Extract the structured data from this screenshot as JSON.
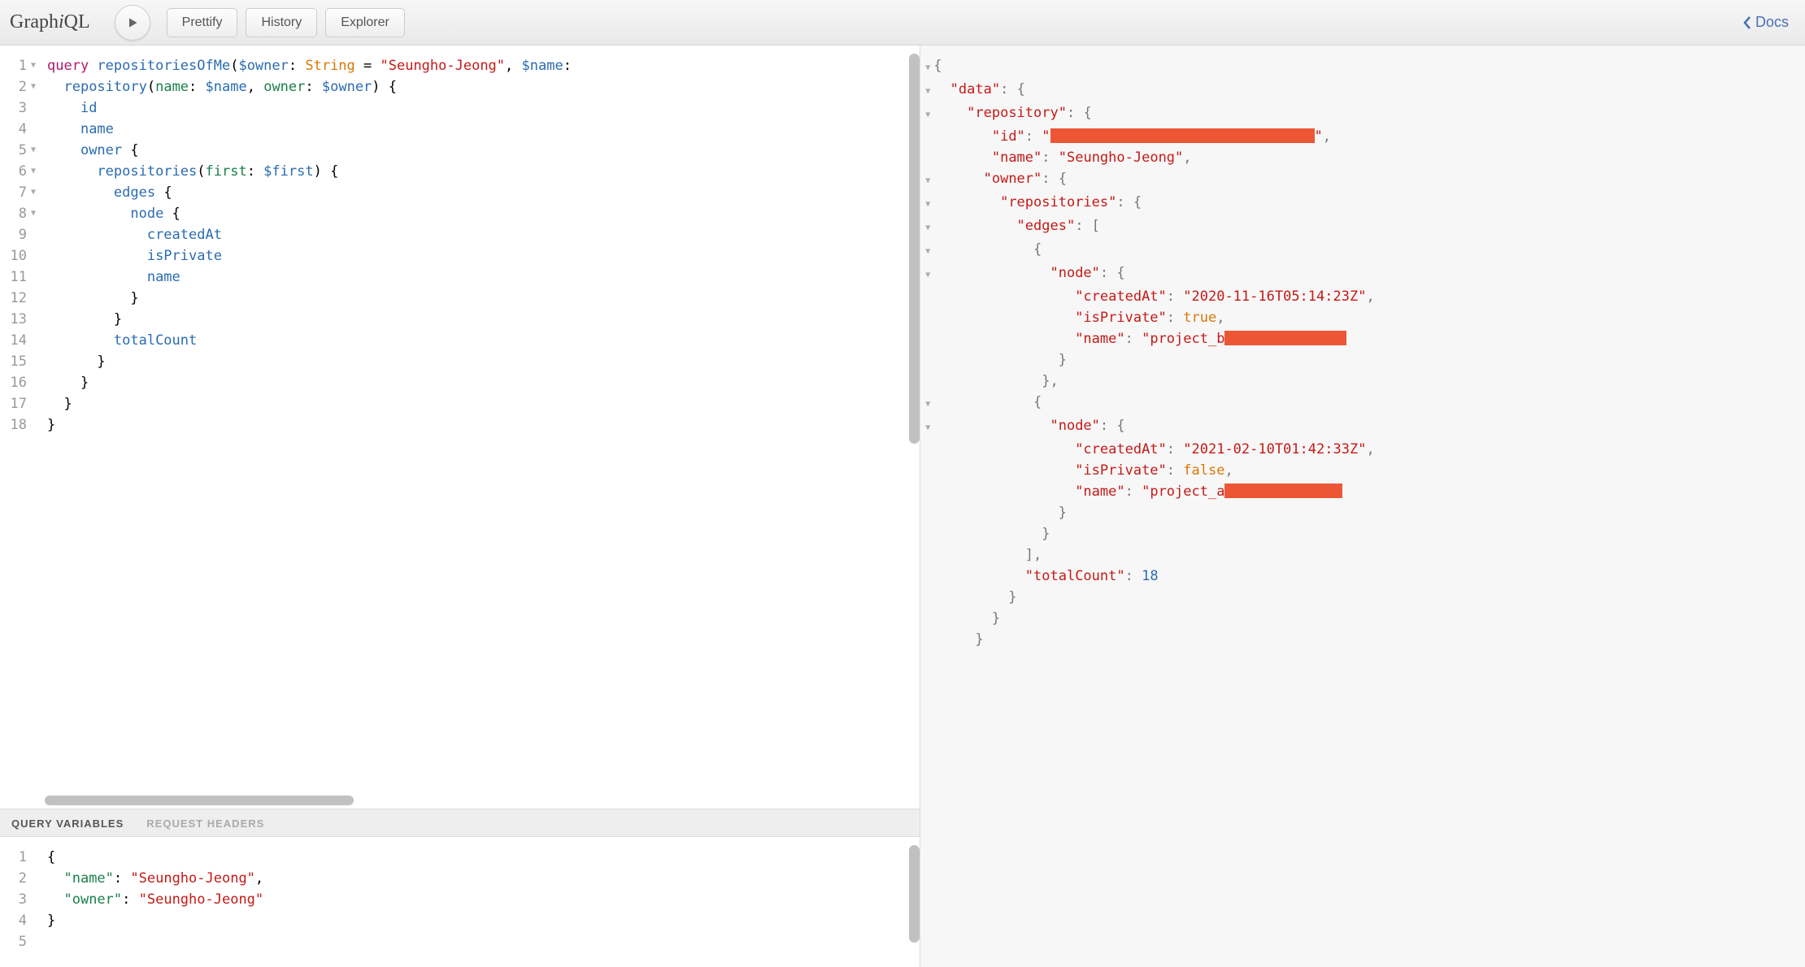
{
  "toolbar": {
    "app_title_parts": [
      "Graph",
      "i",
      "QL"
    ],
    "prettify_label": "Prettify",
    "history_label": "History",
    "explorer_label": "Explorer",
    "docs_label": "Docs"
  },
  "query_editor": {
    "line_count": 18,
    "foldable_lines": [
      1,
      2,
      5,
      6,
      7,
      8
    ],
    "tokens": {
      "l1_kw": "query",
      "l1_name": "repositoriesOfMe",
      "l1_var1": "$owner",
      "l1_type": "String",
      "l1_default": "\"Seungho-Jeong\"",
      "l1_var2": "$name",
      "l2_fn": "repository",
      "l2_arg1": "name",
      "l2_val1": "$name",
      "l2_arg2": "owner",
      "l2_val2": "$owner",
      "l3": "id",
      "l4": "name",
      "l5": "owner",
      "l6_fn": "repositories",
      "l6_arg": "first",
      "l6_val": "$first",
      "l7": "edges",
      "l8": "node",
      "l9": "createdAt",
      "l10": "isPrivate",
      "l11": "name",
      "l14": "totalCount"
    }
  },
  "secondary": {
    "tab_vars": "Query Variables",
    "tab_headers": "Request Headers"
  },
  "vars_editor": {
    "line_count": 5,
    "content": {
      "name_key": "\"name\"",
      "name_val": "\"Seungho-Jeong\"",
      "owner_key": "\"owner\"",
      "owner_val": "\"Seungho-Jeong\""
    }
  },
  "result": {
    "data_key": "\"data\"",
    "repository_key": "\"repository\"",
    "id_key": "\"id\"",
    "name_key": "\"name\"",
    "name_val": "\"Seungho-Jeong\"",
    "owner_key": "\"owner\"",
    "repositories_key": "\"repositories\"",
    "edges_key": "\"edges\"",
    "node_key": "\"node\"",
    "createdAt_key": "\"createdAt\"",
    "isPrivate_key": "\"isPrivate\"",
    "edge1": {
      "createdAt": "\"2020-11-16T05:14:23Z\"",
      "isPrivate": "true",
      "name_prefix": "\"project_b"
    },
    "edge2": {
      "createdAt": "\"2021-02-10T01:42:33Z\"",
      "isPrivate": "false",
      "name_prefix": "\"project_a"
    },
    "totalCount_key": "\"totalCount\"",
    "totalCount_val": "18"
  }
}
